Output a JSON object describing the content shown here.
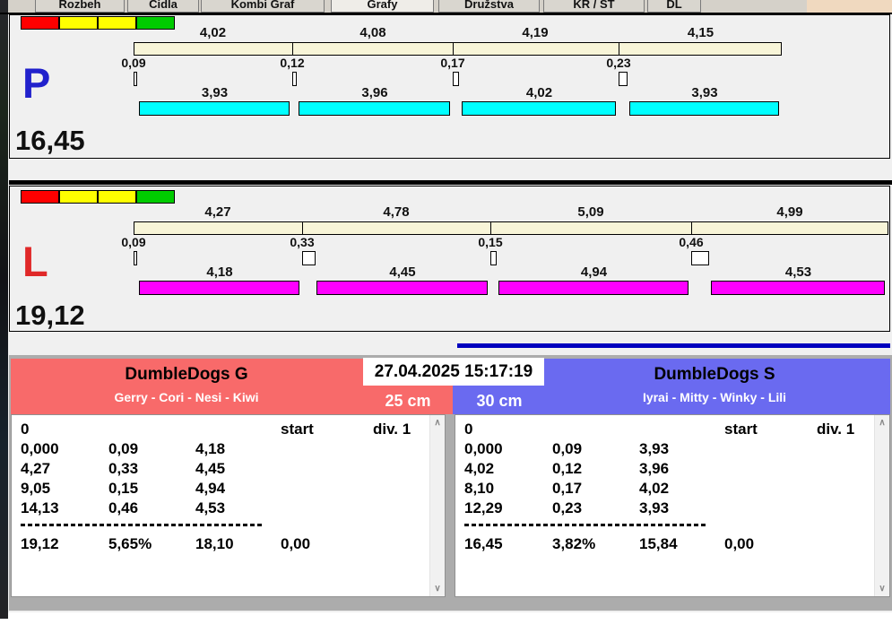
{
  "window": {
    "tabs": [
      {
        "label": "Rozbeh",
        "active": false
      },
      {
        "label": "Cidla",
        "active": false
      },
      {
        "label": "Kombi Graf",
        "active": false
      },
      {
        "label": "Grafy",
        "active": true
      },
      {
        "label": "Družstva",
        "active": false
      },
      {
        "label": "KR / ST",
        "active": false
      },
      {
        "label": "DL",
        "active": false
      }
    ]
  },
  "status_lights": [
    "#FF0000",
    "#FFFF00",
    "#FFFF00",
    "#00CC00"
  ],
  "datetime": "27.04.2025 15:17:19",
  "chart_data": [
    {
      "type": "bar",
      "lane": "P",
      "lane_color": "#2121CC",
      "run_bar_color": "#00FFFF",
      "split_bar_color": "#F8F5D8",
      "total_label": "16,45",
      "total_s": 16.45,
      "segments": [
        {
          "split": "4,02",
          "split_s": 4.02,
          "reaction": "0,09",
          "reaction_s": 0.09,
          "run": "3,93",
          "run_s": 3.93
        },
        {
          "split": "4,08",
          "split_s": 4.08,
          "reaction": "0,12",
          "reaction_s": 0.12,
          "run": "3,96",
          "run_s": 3.96
        },
        {
          "split": "4,19",
          "split_s": 4.19,
          "reaction": "0,17",
          "reaction_s": 0.17,
          "run": "4,02",
          "run_s": 4.02
        },
        {
          "split": "4,15",
          "split_s": 4.15,
          "reaction": "0,23",
          "reaction_s": 0.23,
          "run": "3,93",
          "run_s": 3.93
        }
      ]
    },
    {
      "type": "bar",
      "lane": "L",
      "lane_color": "#E02828",
      "run_bar_color": "#FF00FF",
      "split_bar_color": "#F8F5D8",
      "total_label": "19,12",
      "total_s": 19.12,
      "segments": [
        {
          "split": "4,27",
          "split_s": 4.27,
          "reaction": "0,09",
          "reaction_s": 0.09,
          "run": "4,18",
          "run_s": 4.18
        },
        {
          "split": "4,78",
          "split_s": 4.78,
          "reaction": "0,33",
          "reaction_s": 0.33,
          "run": "4,45",
          "run_s": 4.45
        },
        {
          "split": "5,09",
          "split_s": 5.09,
          "reaction": "0,15",
          "reaction_s": 0.15,
          "run": "4,94",
          "run_s": 4.94
        },
        {
          "split": "4,99",
          "split_s": 4.99,
          "reaction": "0,46",
          "reaction_s": 0.46,
          "run": "4,53",
          "run_s": 4.53
        }
      ]
    }
  ],
  "teams": [
    {
      "name": "DumbleDogs G",
      "dogs": "Gerry - Cori - Nesi - Kiwi",
      "height": "25 cm",
      "header_color": "#F86A6A",
      "table": {
        "header": {
          "col1": "0",
          "start": "start",
          "div": "div. 1"
        },
        "rows": [
          [
            "0,000",
            "0,09",
            "4,18"
          ],
          [
            "4,27",
            "0,33",
            "4,45"
          ],
          [
            "9,05",
            "0,15",
            "4,94"
          ],
          [
            "14,13",
            "0,46",
            "4,53"
          ]
        ],
        "total": [
          "19,12",
          "5,65%",
          "18,10",
          "0,00"
        ]
      }
    },
    {
      "name": "DumbleDogs S",
      "dogs": "Iyrai - Mitty - Winky - Lili",
      "height": "30 cm",
      "header_color": "#6A6AF0",
      "table": {
        "header": {
          "col1": "0",
          "start": "start",
          "div": "div. 1"
        },
        "rows": [
          [
            "0,000",
            "0,09",
            "3,93"
          ],
          [
            "4,02",
            "0,12",
            "3,96"
          ],
          [
            "8,10",
            "0,17",
            "4,02"
          ],
          [
            "12,29",
            "0,23",
            "3,93"
          ]
        ],
        "total": [
          "16,45",
          "3,82%",
          "15,84",
          "0,00"
        ]
      }
    }
  ]
}
